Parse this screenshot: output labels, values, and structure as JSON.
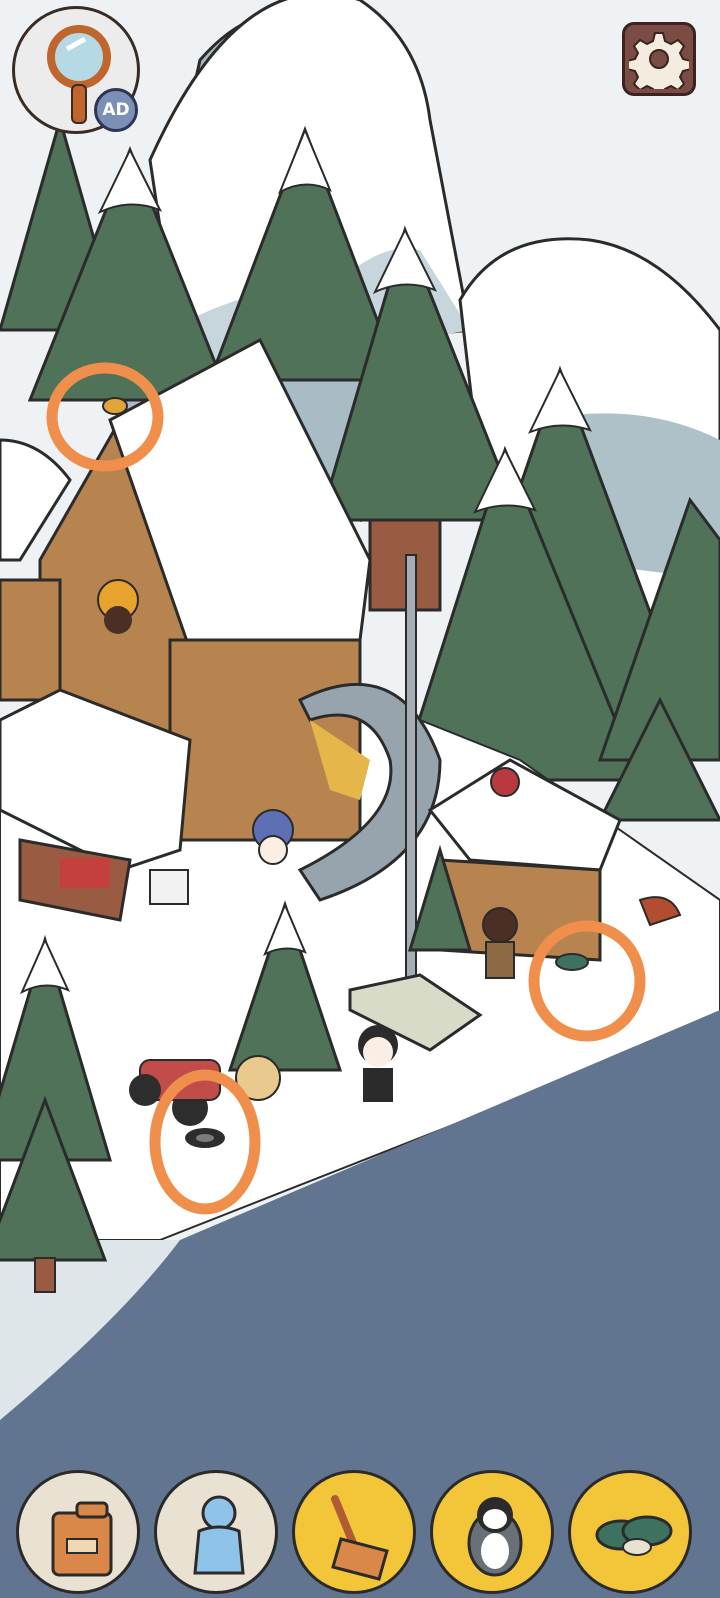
{
  "hud": {
    "hint_button": {
      "icon": "magnifier-icon",
      "badge_label": "AD"
    },
    "settings_button": {
      "icon": "gear-icon"
    }
  },
  "scene": {
    "name": "snowy-mountain-lodge",
    "found_markers": [
      {
        "id": "bird-marker",
        "target": "bird-on-roof"
      },
      {
        "id": "tire-marker",
        "target": "tire"
      },
      {
        "id": "rope-marker",
        "target": "rope"
      }
    ]
  },
  "items_bar": [
    {
      "id": "jerrycan",
      "icon": "jerrycan-icon",
      "state": "pending"
    },
    {
      "id": "ice-statue",
      "icon": "ice-statue-icon",
      "state": "pending"
    },
    {
      "id": "snow-shovel",
      "icon": "snow-shovel-icon",
      "state": "found"
    },
    {
      "id": "penguin",
      "icon": "penguin-icon",
      "state": "found"
    },
    {
      "id": "rope",
      "icon": "rope-icon",
      "state": "found"
    }
  ],
  "colors": {
    "marker": "#ef8f4b",
    "found_slot": "#f3c63a",
    "pending_slot": "#e9e1d2",
    "tree": "#4f7259",
    "water": "#627590",
    "snow": "#ffffff"
  }
}
